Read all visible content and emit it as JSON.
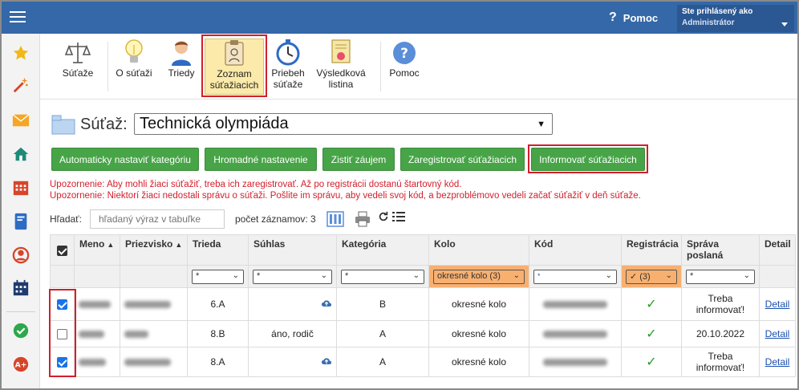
{
  "topbar": {
    "help_label": "Pomoc",
    "user_line1": "Ste prihlásený ako",
    "user_line2": "Administrátor"
  },
  "sidebar": {
    "icons": [
      "star-icon",
      "wand-icon",
      "envelope-icon",
      "home-icon",
      "calendar-icon",
      "book-icon",
      "user-circle-icon",
      "schedule-icon",
      "check-circle-icon",
      "award-icon"
    ]
  },
  "toolbar": {
    "items": [
      {
        "label": "Súťaže",
        "icon": "scales-icon"
      },
      {
        "label": "O súťaži",
        "icon": "lightbulb-icon"
      },
      {
        "label": "Triedy",
        "icon": "student-icon"
      },
      {
        "label": "Zoznam súťažiacich",
        "label_l1": "Zoznam",
        "label_l2": "súťažiacich",
        "icon": "clipboard-icon"
      },
      {
        "label": "Priebeh súťaže",
        "label_l1": "Priebeh",
        "label_l2": "súťaže",
        "icon": "stopwatch-icon"
      },
      {
        "label": "Výsledková listina",
        "label_l1": "Výsledková",
        "label_l2": "listina",
        "icon": "certificate-icon"
      },
      {
        "label": "Pomoc",
        "icon": "help-icon"
      }
    ]
  },
  "competition": {
    "label": "Súťaž:",
    "selected": "Technická olympiáda"
  },
  "actions": {
    "auto_category": "Automaticky nastaviť kategóriu",
    "bulk_settings": "Hromadné nastavenie",
    "find_interest": "Zistiť záujem",
    "register": "Zaregistrovať súťažiacich",
    "inform": "Informovať súťažiacich"
  },
  "warnings": {
    "w1": "Upozornenie: Aby mohli žiaci súťažiť, treba ich zaregistrovať. Až po registrácii dostanú štartovný kód.",
    "w2": "Upozornenie: Niektorí žiaci nedostali správu o súťaži. Pošlite im správu, aby vedeli svoj kód, a bezproblémovo vedeli začať súťažiť v deň súťaže."
  },
  "search": {
    "label": "Hľadať:",
    "placeholder": "hľadaný výraz v tabuľke",
    "count_label": "počet záznamov: 3"
  },
  "table": {
    "headers": {
      "meno": "Meno",
      "priezvisko": "Priezvisko",
      "trieda": "Trieda",
      "suhlas": "Súhlas",
      "kategoria": "Kategória",
      "kolo": "Kolo",
      "kod": "Kód",
      "registracia": "Registrácia",
      "sprava": "Správa poslaná",
      "detail": "Detail"
    },
    "filters": {
      "trieda": "*",
      "suhlas": "*",
      "kategoria": "*",
      "kolo": "okresné kolo (3)",
      "kod": "*",
      "registracia": "✓ (3)",
      "sprava": "*"
    },
    "rows": [
      {
        "checked": true,
        "trieda": "6.A",
        "suhlas": "",
        "kategoria": "B",
        "kolo": "okresné kolo",
        "registracia": "✓",
        "sprava": "Treba informovať!",
        "detail": "Detail"
      },
      {
        "checked": false,
        "trieda": "8.B",
        "suhlas": "áno, rodič",
        "kategoria": "A",
        "kolo": "okresné kolo",
        "registracia": "✓",
        "sprava": "20.10.2022",
        "detail": "Detail"
      },
      {
        "checked": true,
        "trieda": "8.A",
        "suhlas": "",
        "kategoria": "A",
        "kolo": "okresné kolo",
        "registracia": "✓",
        "sprava": "Treba informovať!",
        "detail": "Detail"
      }
    ]
  },
  "colors": {
    "topbar": "#3468a8",
    "button_green": "#47a447",
    "warning_red": "#d21f2b",
    "highlight_orange": "#f8b070",
    "active_tab": "#fbeaa9"
  }
}
